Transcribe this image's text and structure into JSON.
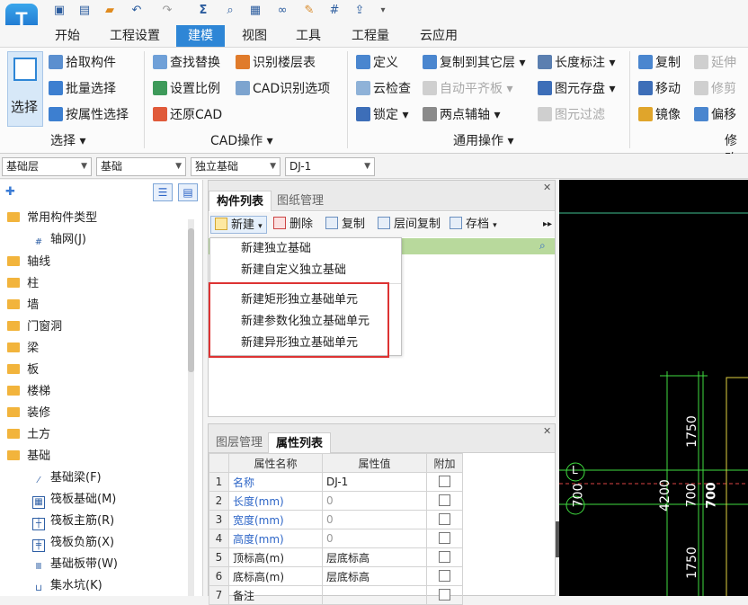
{
  "app": {
    "logo_letter": "T",
    "brand_color": "#2e86d6"
  },
  "quick_access": {
    "icons": [
      "save-icon",
      "new-file-icon",
      "open-folder-icon",
      "undo-icon",
      "redo-icon",
      "sum-icon",
      "find-icon",
      "view-icon",
      "glasses-icon",
      "edit-icon",
      "grid-icon",
      "export-icon",
      "more-icon"
    ]
  },
  "tabs": [
    "开始",
    "工程设置",
    "建模",
    "视图",
    "工具",
    "工程量",
    "云应用"
  ],
  "ribbon": {
    "select_big": "选择",
    "select_group": {
      "items": [
        "拾取构件",
        "批量选择",
        "按属性选择"
      ],
      "label": "选择"
    },
    "cad_group": {
      "items": [
        "查找替换",
        "识别楼层表",
        "设置比例",
        "CAD识别选项",
        "还原CAD"
      ],
      "label": "CAD操作"
    },
    "common_group": {
      "items": [
        "定义",
        "复制到其它层",
        "云检查",
        "自动平齐板",
        "锁定",
        "两点辅轴"
      ],
      "label": "通用操作"
    },
    "length_group": {
      "items": [
        "长度标注",
        "图元存盘",
        "图元过滤"
      ]
    },
    "modify_group": {
      "items": [
        "复制",
        "延伸",
        "移动",
        "修剪",
        "镜像",
        "偏移"
      ],
      "label": "修改"
    }
  },
  "combos": [
    "基础层",
    "基础",
    "独立基础",
    "DJ-1"
  ],
  "tree": {
    "header": "常用构件类型",
    "axis": "轴网(J)",
    "categories": [
      "轴线",
      "柱",
      "墙",
      "门窗洞",
      "梁",
      "板",
      "楼梯",
      "装修",
      "土方",
      "基础"
    ],
    "foundation_items": [
      "基础梁(F)",
      "筏板基础(M)",
      "筏板主筋(R)",
      "筏板负筋(X)",
      "基础板带(W)",
      "集水坑(K)"
    ]
  },
  "component_panel": {
    "tabs": [
      "构件列表",
      "图纸管理"
    ],
    "toolbar": [
      "新建",
      "删除",
      "复制",
      "层间复制",
      "存档"
    ],
    "menu": [
      "新建独立基础",
      "新建自定义独立基础",
      "新建矩形独立基础单元",
      "新建参数化独立基础单元",
      "新建异形独立基础单元"
    ]
  },
  "property_panel": {
    "tabs": [
      "图层管理",
      "属性列表"
    ],
    "headers": [
      "属性名称",
      "属性值",
      "附加"
    ],
    "rows": [
      {
        "n": "1",
        "name": "名称",
        "value": "DJ-1"
      },
      {
        "n": "2",
        "name": "长度(mm)",
        "value": "0"
      },
      {
        "n": "3",
        "name": "宽度(mm)",
        "value": "0"
      },
      {
        "n": "4",
        "name": "高度(mm)",
        "value": "0"
      },
      {
        "n": "5",
        "name": "顶标高(m)",
        "value": "层底标高"
      },
      {
        "n": "6",
        "name": "底标高(m)",
        "value": "层底标高"
      },
      {
        "n": "7",
        "name": "备注",
        "value": ""
      }
    ]
  },
  "cad": {
    "dims": [
      "1750",
      "700",
      "4200",
      "700",
      "700",
      "1750"
    ],
    "axis_label": "L"
  }
}
